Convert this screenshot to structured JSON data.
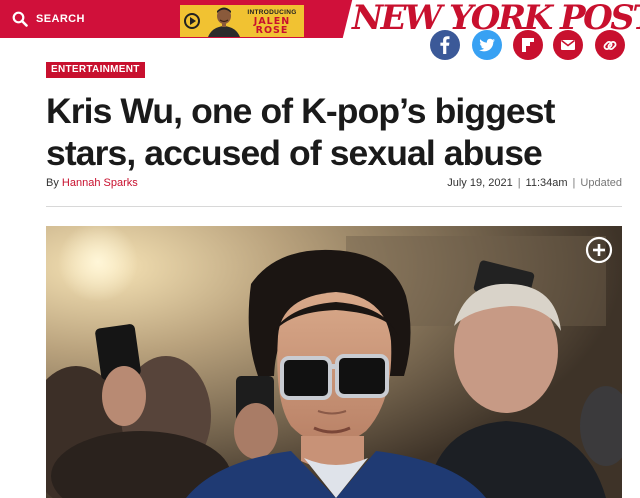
{
  "header": {
    "search_label": "SEARCH",
    "promo_kicker": "INTRODUCING",
    "promo_name_1": "JALEN",
    "promo_name_2": "ROSE",
    "logo_text": "NEW YORK POST",
    "brand_color": "#c8102e"
  },
  "share": {
    "items": [
      "facebook-icon",
      "twitter-icon",
      "flipboard-icon",
      "email-icon",
      "copy-link-icon"
    ]
  },
  "article": {
    "section": "ENTERTAINMENT",
    "headline": "Kris Wu, one of K-pop’s biggest stars, accused of sexual abuse",
    "byline_prefix": "By",
    "author": "Hannah Sparks",
    "date": "July 19, 2021",
    "time": "11:34am",
    "sep": "|",
    "updated": "Updated"
  },
  "photo": {
    "description_icon": "photo",
    "expand_icon": "plus-circle-icon"
  }
}
